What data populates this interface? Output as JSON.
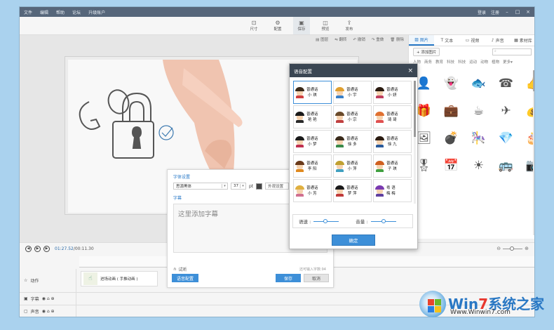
{
  "menu": {
    "items": [
      "文件",
      "编辑",
      "帮助",
      "论坛",
      "升级账户"
    ]
  },
  "account": {
    "login": "登录",
    "register": "注册"
  },
  "toolbar": {
    "items": [
      {
        "label": "尺寸",
        "icon": "size-icon"
      },
      {
        "label": "配置",
        "icon": "gear-icon"
      },
      {
        "label": "保存",
        "icon": "save-icon"
      },
      {
        "label": "预览",
        "icon": "preview-icon"
      },
      {
        "label": "发布",
        "icon": "publish-icon"
      }
    ]
  },
  "canvas_tools": [
    "图层",
    "翻转",
    "撤销",
    "重做",
    "删除"
  ],
  "right_panel": {
    "tabs": [
      {
        "label": "图片",
        "icon": "image-icon"
      },
      {
        "label": "文本",
        "icon": "text-icon"
      },
      {
        "label": "视频",
        "icon": "video-icon"
      },
      {
        "label": "声音",
        "icon": "sound-icon"
      },
      {
        "label": "素材库",
        "icon": "library-icon"
      }
    ],
    "add_image": "+ 添加图片",
    "categories": [
      "人物",
      "商务",
      "教育",
      "科技",
      "科技",
      "运动",
      "动物",
      "植物",
      "更多▾"
    ],
    "icons": [
      "👤",
      "👻",
      "🐟",
      "☎",
      "👍",
      "🎁",
      "💼",
      "☕",
      "✈",
      "💰",
      "🖼",
      "💣",
      "🎠",
      "💎",
      "🎂",
      "🎖",
      "📅",
      "☀",
      "🚌",
      "📷"
    ]
  },
  "timeline": {
    "current": "01:27.52",
    "total": "/00:11.30",
    "tracks": [
      {
        "label": "动作",
        "icon": "star-icon"
      },
      {
        "label": "字幕",
        "icon": "subtitle-icon"
      },
      {
        "label": "声音",
        "icon": "audio-icon"
      }
    ],
    "motion_clip": "进场动画 ( 手推动画 )"
  },
  "subtitle_panel": {
    "font_section": "字体设置",
    "font": "思源黑体",
    "size": "37",
    "unit": "pt",
    "outline_label": "外观设置",
    "subtitle_section": "字幕",
    "placeholder": "这里添加字幕",
    "listen": "试听",
    "counter": "还可输入字数:94",
    "voice_config": "语音配置",
    "save": "保存",
    "cancel": "取消"
  },
  "voice_dialog": {
    "title": "语音配置",
    "voices": [
      {
        "line1": "普通话",
        "line2": "小 琪",
        "hair": "#3a2a1a",
        "body": "#d04040"
      },
      {
        "line1": "普通话",
        "line2": "小 宇",
        "hair": "#e0a030",
        "body": "#3a80c8"
      },
      {
        "line1": "普通话",
        "line2": "小 妍",
        "hair": "#2a1a10",
        "body": "#c04060"
      },
      {
        "line1": "普通话",
        "line2": "艳 艳",
        "hair": "#1a1a1a",
        "body": "#2a2a2a"
      },
      {
        "line1": "普通话",
        "line2": "小 宗",
        "hair": "#6a4a2a",
        "body": "#c04040"
      },
      {
        "line1": "普通话",
        "line2": "琦 琦",
        "hair": "#e07030",
        "body": "#e05050"
      },
      {
        "line1": "普通话",
        "line2": "小 梦",
        "hair": "#1a1a1a",
        "body": "#c03050"
      },
      {
        "line1": "普通话",
        "line2": "徐 多",
        "hair": "#3a2a1a",
        "body": "#3a8a4a"
      },
      {
        "line1": "普通话",
        "line2": "徐 九",
        "hair": "#2a1a10",
        "body": "#2a5a9a"
      },
      {
        "line1": "普通话",
        "line2": "李 阳",
        "hair": "#6a3a1a",
        "body": "#e08a20"
      },
      {
        "line1": "普通话",
        "line2": "小 萍",
        "hair": "#c0a030",
        "body": "#40a0c0"
      },
      {
        "line1": "普通话",
        "line2": "子 琪",
        "hair": "#d06020",
        "body": "#40a040"
      },
      {
        "line1": "普通话",
        "line2": "小 芳",
        "hair": "#e0b040",
        "body": "#d07090"
      },
      {
        "line1": "普通话",
        "line2": "梦 萍",
        "hair": "#1a1a1a",
        "body": "#c03a3a"
      },
      {
        "line1": "粤 语",
        "line2": "梅 梅",
        "hair": "#7a3ab0",
        "body": "#6040a0"
      }
    ],
    "speed_label": "语速 :",
    "volume_label": "音量 :",
    "speed": 0.45,
    "volume": 0.5,
    "ok": "确定"
  },
  "watermark": {
    "brand_a": "Win",
    "brand_num": "7",
    "brand_b": "系统之家",
    "url": "Www.Winwin7.com"
  }
}
